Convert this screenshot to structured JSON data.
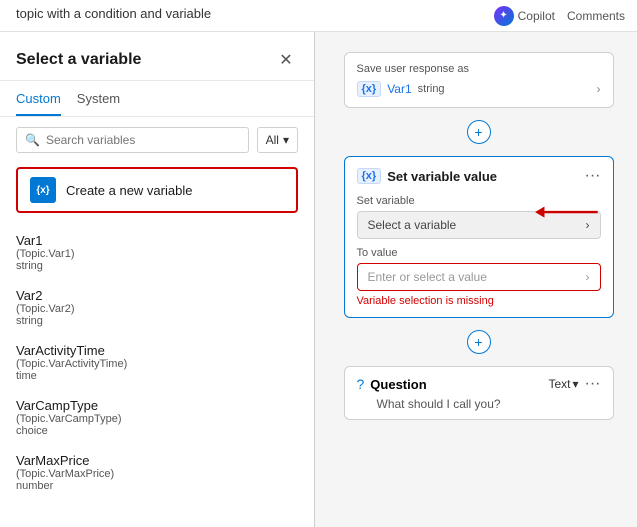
{
  "topbar": {
    "title": "topic with a condition and variable",
    "copilot_label": "Copilot",
    "comments_label": "Comments"
  },
  "panel": {
    "title": "Select a variable",
    "tabs": [
      "Custom",
      "System"
    ],
    "active_tab": 0,
    "search_placeholder": "Search variables",
    "filter_label": "All",
    "create_new_label": "Create a new variable",
    "create_new_icon": "{x}",
    "variables": [
      {
        "name": "Var1",
        "topic": "(Topic.Var1)",
        "type": "string"
      },
      {
        "name": "Var2",
        "topic": "(Topic.Var2)",
        "type": "string"
      },
      {
        "name": "VarActivityTime",
        "topic": "(Topic.VarActivityTime)",
        "type": "time"
      },
      {
        "name": "VarCampType",
        "topic": "(Topic.VarCampType)",
        "type": "choice"
      },
      {
        "name": "VarMaxPrice",
        "topic": "(Topic.VarMaxPrice)",
        "type": "number"
      }
    ]
  },
  "canvas": {
    "save_response_label": "Save user response as",
    "var_badge": "{x}",
    "var1_name": "Var1",
    "var1_type": "string",
    "set_var_title": "Set variable value",
    "set_var_label": "Set variable",
    "select_var_placeholder": "Select a variable",
    "to_value_label": "To value",
    "enter_value_placeholder": "Enter or select a value",
    "error_message": "Variable selection is missing",
    "question_label": "Question",
    "question_type": "Text",
    "question_sub": "What should I call you?"
  }
}
